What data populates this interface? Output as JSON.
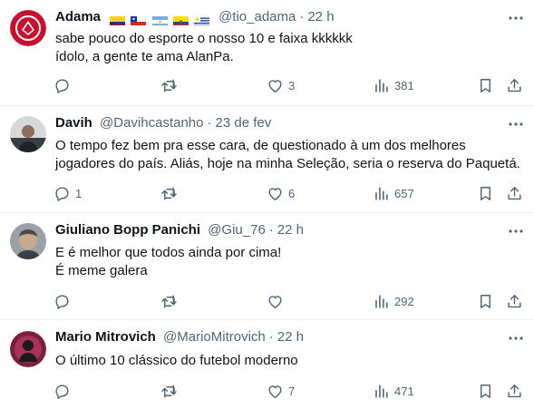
{
  "tweets": [
    {
      "name": "Adama",
      "handle": "@tio_adama",
      "time": "22 h",
      "flags": [
        "colombia-flag",
        "chile-flag",
        "argentina-flag",
        "ecuador-flag",
        "uruguay-flag"
      ],
      "lines": [
        "sabe pouco do esporte o nosso 10 e faixa kkkkkk",
        "ídolo, a gente te ama AlanPa."
      ],
      "replies": "",
      "retweets": "",
      "likes": "3",
      "views": "381"
    },
    {
      "name": "Davih",
      "handle": "@Davihcastanho",
      "time": "23 de fev",
      "lines": [
        "O tempo fez bem pra esse cara, de questionado à um dos melhores",
        "jogadores do país. Aliás, hoje na minha Seleção, seria o reserva do Paquetá."
      ],
      "replies": "1",
      "retweets": "",
      "likes": "6",
      "views": "657"
    },
    {
      "name": "Giuliano Bopp Panichi",
      "handle": "@Giu_76",
      "time": "22 h",
      "lines": [
        "E é melhor que todos ainda por cima!",
        "É meme galera"
      ],
      "replies": "",
      "retweets": "",
      "likes": "",
      "views": "292"
    },
    {
      "name": "Mario Mitrovich",
      "handle": "@MarioMitrovich",
      "time": "22 h",
      "lines": [
        "O último 10 clássico do futebol moderno"
      ],
      "replies": "",
      "retweets": "",
      "likes": "7",
      "views": "471"
    }
  ],
  "icons": {
    "reply": "reply-icon",
    "retweet": "retweet-icon",
    "like": "like-icon",
    "views": "views-icon",
    "bookmark": "bookmark-icon",
    "share": "share-icon",
    "more": "more-icon"
  },
  "colors": {
    "text": "#0f1419",
    "secondary": "#536471",
    "divider": "#eff3f4"
  }
}
